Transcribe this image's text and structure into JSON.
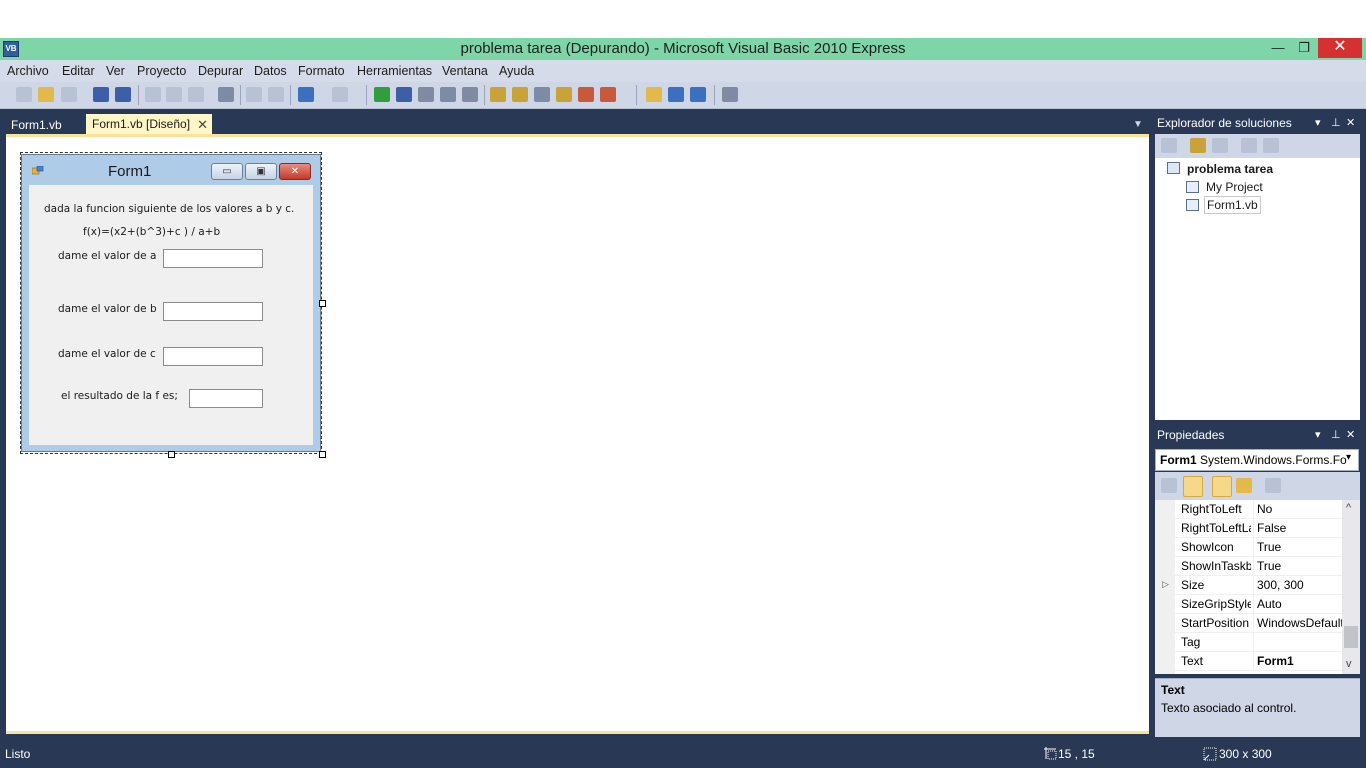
{
  "window": {
    "title": "problema tarea (Depurando) - Microsoft Visual Basic 2010 Express",
    "icon_text": "VB",
    "min_glyph": "—",
    "max_glyph": "❐",
    "close_glyph": "✕"
  },
  "menu": [
    "Archivo",
    "Editar",
    "Ver",
    "Proyecto",
    "Depurar",
    "Datos",
    "Formato",
    "Herramientas",
    "Ventana",
    "Ayuda"
  ],
  "tabs": [
    {
      "label": "Form1.vb"
    },
    {
      "label": "Form1.vb [Diseño]",
      "close": "✕"
    }
  ],
  "tab_dropdown": "▼",
  "form": {
    "title": "Form1",
    "min_glyph": "▭",
    "max_glyph": "▣",
    "close_glyph": "✕",
    "labels": {
      "intro": "dada la funcion siguiente  de los valores  a b y c.",
      "formula": "f(x)=(x2+(b^3)+c ) / a+b",
      "a": "dame el valor de a",
      "b": "dame el valor de b",
      "c": "dame el valor de c",
      "result": "el resultado de la f es;"
    },
    "textboxes": {
      "a": "",
      "b": "",
      "c": "",
      "result": ""
    }
  },
  "solution_explorer": {
    "title": "Explorador de soluciones",
    "controls": {
      "dropdown": "▾",
      "pin": "⊥",
      "close": "✕"
    },
    "tree": [
      {
        "label": "problema tarea",
        "bold": true
      },
      {
        "label": "My Project"
      },
      {
        "label": "Form1.vb"
      }
    ]
  },
  "properties": {
    "title": "Propiedades",
    "controls": {
      "dropdown": "▾",
      "pin": "⊥",
      "close": "✕"
    },
    "object": {
      "name": "Form1",
      "type": "System.Windows.Forms.Fo",
      "arrow": "▾"
    },
    "rows": [
      {
        "name": "RightToLeft",
        "value": "No"
      },
      {
        "name": "RightToLeftLa",
        "value": "False"
      },
      {
        "name": "ShowIcon",
        "value": "True"
      },
      {
        "name": "ShowInTaskb",
        "value": "True"
      },
      {
        "name": "Size",
        "value": "300, 300",
        "expand": "▷"
      },
      {
        "name": "SizeGripStyle",
        "value": "Auto"
      },
      {
        "name": "StartPosition",
        "value": "WindowsDefault"
      },
      {
        "name": "Tag",
        "value": ""
      },
      {
        "name": "Text",
        "value": "Form1",
        "bold": true
      }
    ],
    "scroll_up": "^",
    "scroll_down": "v",
    "description": {
      "title": "Text",
      "text": "Texto asociado al control."
    }
  },
  "status": {
    "text": "Listo",
    "position": "15 , 15",
    "size": "300 x 300"
  },
  "colors": {
    "titlebar": "#7ed6a8",
    "frame": "#293955",
    "active_tab": "#fff6c7",
    "close_red": "#d63131"
  }
}
